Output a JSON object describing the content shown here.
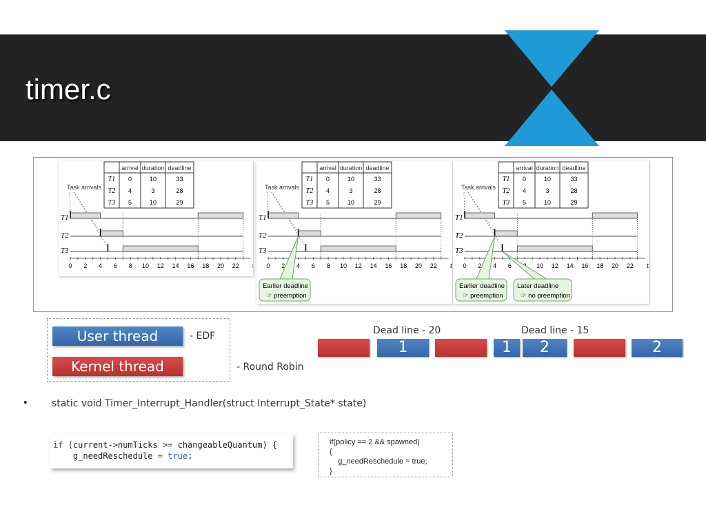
{
  "slide": {
    "title": "timer.c",
    "accent": "#1e9ad6",
    "band_color": "#232323"
  },
  "diagram": {
    "table_headers": [
      "",
      "arrival",
      "duration",
      "deadline"
    ],
    "tasks": [
      {
        "name": "T1",
        "arrival": 0,
        "duration": 10,
        "deadline": 33
      },
      {
        "name": "T2",
        "arrival": 4,
        "duration": 3,
        "deadline": 28
      },
      {
        "name": "T3",
        "arrival": 5,
        "duration": 10,
        "deadline": 29
      }
    ],
    "task_arrivals_label": "Task arrivals",
    "schedule": {
      "T1": [
        [
          0,
          4
        ],
        [
          17,
          23
        ]
      ],
      "T2": [
        [
          4,
          7
        ]
      ],
      "T3": [
        [
          7,
          17
        ]
      ]
    },
    "axis_ticks": [
      0,
      2,
      4,
      6,
      8,
      10,
      12,
      14,
      16,
      18,
      20,
      22
    ],
    "axis_label": "t",
    "panels": [
      {
        "callouts": []
      },
      {
        "callouts": [
          {
            "line1": "Earlier deadline",
            "line2": "☞ preemption"
          }
        ]
      },
      {
        "callouts": [
          {
            "line1": "Earlier deadline",
            "line2": "☞ preemption"
          },
          {
            "line1": "Later deadline",
            "line2": "☞ no preemption"
          }
        ]
      }
    ]
  },
  "legend": {
    "user_thread": "User thread",
    "user_policy": "- EDF",
    "kernel_thread": "Kernel thread",
    "kernel_policy": "- Round Robin",
    "user_color": "#3f76b8",
    "kernel_color": "#c83c3c"
  },
  "timeline": {
    "deadline_a": "Dead line - 20",
    "deadline_b": "Dead line - 15",
    "blocks": [
      {
        "type": "kernel",
        "label": ""
      },
      {
        "type": "user",
        "label": "1"
      },
      {
        "type": "kernel",
        "label": ""
      },
      {
        "type": "user",
        "label": "1"
      },
      {
        "type": "user",
        "label": "2"
      },
      {
        "type": "kernel",
        "label": ""
      },
      {
        "type": "user",
        "label": "2"
      }
    ]
  },
  "bullet": {
    "marker": "•",
    "text": "static void Timer_Interrupt_Handler(struct Interrupt_State* state)"
  },
  "code1": {
    "kw_if": "if",
    "line1_rest": " (current->numTicks >= changeableQuantum) {",
    "line2_pre": "    g_needReschedule = ",
    "kw_true": "true",
    "line2_post": ";"
  },
  "code2": {
    "text": "if(policy == 2 && spawned)\n{\n    g_needReschedule = true;\n}"
  }
}
